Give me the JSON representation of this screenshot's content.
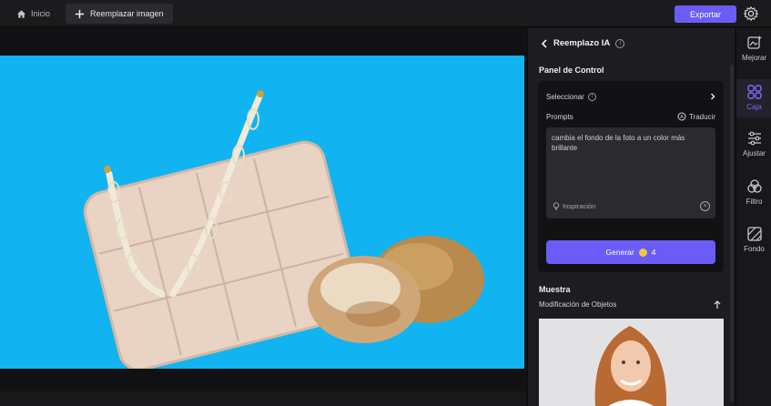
{
  "topbar": {
    "home_label": "Inicio",
    "replace_label": "Reemplazar imagen",
    "export_label": "Exportar"
  },
  "panel": {
    "title": "Reemplazo IA",
    "control_title": "Panel de Control",
    "select_label": "Seleccionar",
    "prompts_label": "Prompts",
    "translate_label": "Traducir",
    "prompt_text": "cambia el fondo de la foto a un color más brillante",
    "inspiration_label": "Inspiración",
    "generate_label": "Generar",
    "generate_cost": "4",
    "sample_title": "Muestra",
    "sample_subtitle": "Modificación de Objetos"
  },
  "rail": {
    "items": [
      {
        "label": "Mejorar",
        "icon": "enhance-icon"
      },
      {
        "label": "Caja",
        "icon": "grid-icon",
        "active": true
      },
      {
        "label": "Ajustar",
        "icon": "sliders-icon"
      },
      {
        "label": "Filtro",
        "icon": "filter-icon"
      },
      {
        "label": "Fondo",
        "icon": "background-icon"
      }
    ]
  },
  "colors": {
    "accent": "#6c5cf6",
    "canvas_background": "#11b4f0"
  }
}
